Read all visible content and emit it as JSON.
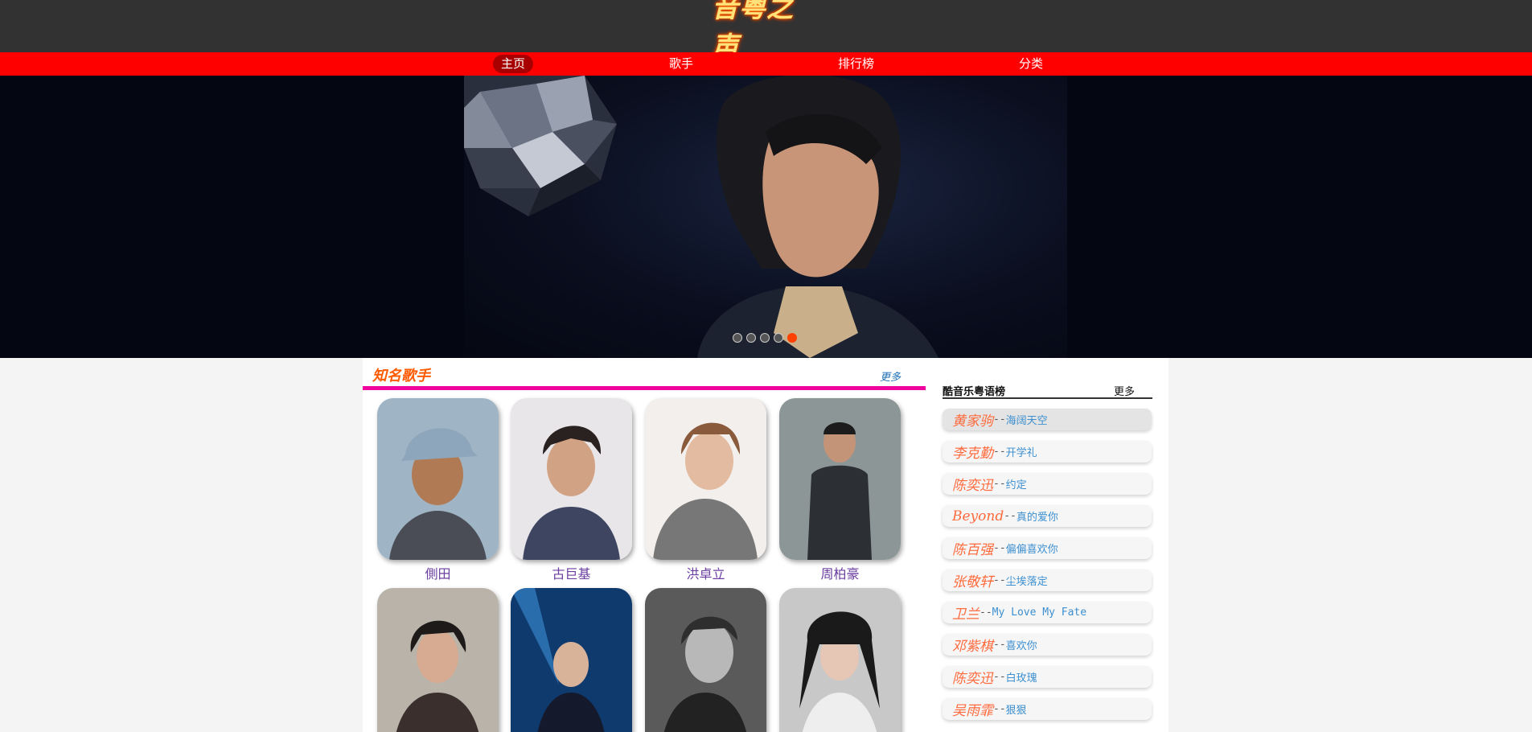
{
  "header": {
    "logo_text": "音粤之声"
  },
  "nav": {
    "items": [
      {
        "label": "主页",
        "active": true
      },
      {
        "label": "歌手",
        "active": false
      },
      {
        "label": "排行榜",
        "active": false
      },
      {
        "label": "分类",
        "active": false
      }
    ]
  },
  "banner": {
    "slide_count": 5,
    "active_slide": 5
  },
  "singers_section": {
    "title": "知名歌手",
    "more_label": "更多",
    "singers": [
      {
        "name": "側田"
      },
      {
        "name": "古巨基"
      },
      {
        "name": "洪卓立"
      },
      {
        "name": "周柏豪"
      },
      {
        "name": ""
      },
      {
        "name": ""
      },
      {
        "name": ""
      },
      {
        "name": ""
      }
    ]
  },
  "chart": {
    "title": "酷音乐粤语榜",
    "more_label": "更多",
    "items": [
      {
        "artist": "黄家驹",
        "song": "海阔天空"
      },
      {
        "artist": "李克勤",
        "song": "开学礼"
      },
      {
        "artist": "陈奕迅",
        "song": "约定"
      },
      {
        "artist": "Beyond",
        "song": "真的爱你"
      },
      {
        "artist": "陈百强",
        "song": "偏偏喜欢你"
      },
      {
        "artist": "张敬轩",
        "song": "尘埃落定"
      },
      {
        "artist": "卫兰",
        "song": "My Love My Fate"
      },
      {
        "artist": "邓紫棋",
        "song": "喜欢你"
      },
      {
        "artist": "陈奕迅",
        "song": "白玫瑰"
      },
      {
        "artist": "吴雨霏",
        "song": "狠狠"
      }
    ],
    "separator": "--"
  },
  "colors": {
    "header_bg": "#323232",
    "nav_bg": "#ff0000",
    "section_rule": "#f0009c",
    "artist_text": "#ff6a3c",
    "song_text": "#3c8fd0",
    "singer_caption": "#6a3ea0"
  }
}
